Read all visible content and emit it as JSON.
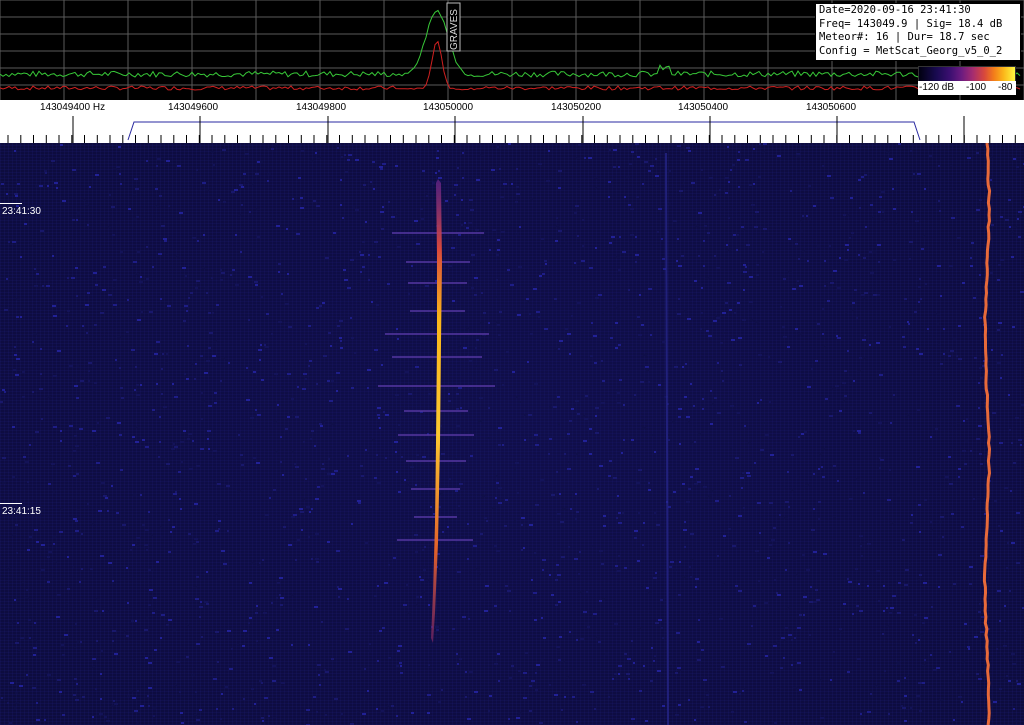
{
  "spectrum": {
    "peak_label": "GRAVES",
    "colors": {
      "average": "#38c838",
      "instant": "#d02020",
      "grid": "#6c6c6c",
      "background": "#000000"
    }
  },
  "info": {
    "date_line": "Date=2020-09-16 23:41:30",
    "freq_line": "Freq= 143049.9 | Sig= 18.4 dB",
    "meteor_line": "Meteor#: 16 | Dur= 18.7 sec",
    "config_line": "Config = MetScat_Georg_v5_0_2"
  },
  "colorbar": {
    "labels": [
      "-120 dB",
      "-100",
      "-80"
    ],
    "min_db": -120,
    "max_db": -80
  },
  "freq_axis": {
    "unit": "Hz",
    "labels": [
      "143049400",
      "143049600",
      "143049800",
      "143050000",
      "143050200",
      "143050400",
      "143050600"
    ]
  },
  "waterfall": {
    "time_labels": [
      "23:41:30",
      "23:41:15"
    ],
    "meteor_color": "#f5a623",
    "carrier_color": "#e86a3a"
  }
}
